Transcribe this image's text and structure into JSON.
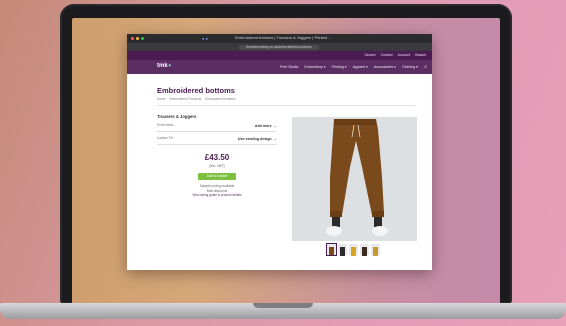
{
  "browser": {
    "tab_title": "Embroidered bottoms | Trousers & Joggers | Printed ...",
    "url": "threadmonkey.co.uk/embroidered-bottoms"
  },
  "site": {
    "top_links": [
      "Search",
      "Contact",
      "Account",
      "Basket"
    ],
    "logo": "tmk",
    "nav": [
      "Print Studio",
      "Embroidery ▾",
      "Printing ▾",
      "Apparel ▾",
      "Accessories ▾",
      "Clothing ▾"
    ]
  },
  "page": {
    "title": "Embroidered bottoms",
    "breadcrumb": [
      "Home",
      "Embroidered Products",
      "Embroidered bottoms"
    ]
  },
  "options": {
    "heading": "Trousers & Joggers",
    "rows": [
      {
        "label": "Embroider...",
        "value": "Add more"
      },
      {
        "label": "Ladies Fit",
        "value": "Use existing design"
      }
    ]
  },
  "purchase": {
    "price": "£43.50",
    "vat": "(Inc. VAT)",
    "add_button": "Add to basket",
    "note_1": "Sample pricing available",
    "note_2": "Bulk discounts",
    "note_link": "View sizing guide & product details"
  },
  "colors": {
    "purple_dark": "#4a1c52",
    "purple": "#5a2d63",
    "green": "#7cc13e",
    "trouser_brown": "#7a4a1c"
  }
}
